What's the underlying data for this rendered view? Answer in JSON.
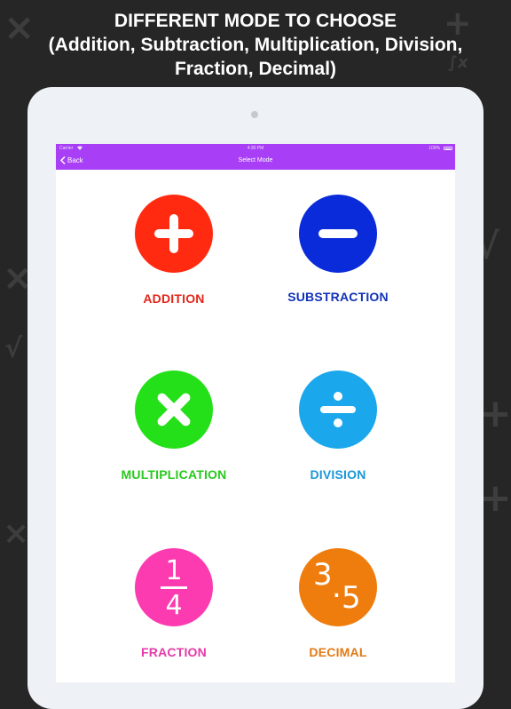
{
  "headline": {
    "line1": "DIFFERENT MODE TO CHOOSE",
    "line2": "(Addition, Subtraction, Multiplication, Division,",
    "line3": "Fraction, Decimal)"
  },
  "status_bar": {
    "carrier": "Carrier",
    "time": "4:30 PM",
    "battery": "100%"
  },
  "nav": {
    "back_label": "Back",
    "title": "Select Mode"
  },
  "modes": [
    {
      "label": "ADDITION",
      "color": "#ff2a0f",
      "icon": "plus-icon"
    },
    {
      "label": "SUBSTRACTION",
      "color": "#0a2bd9",
      "icon": "minus-icon"
    },
    {
      "label": "MULTIPLICATION",
      "color": "#24e019",
      "icon": "multiply-icon"
    },
    {
      "label": "DIVISION",
      "color": "#1aa7ec",
      "icon": "divide-icon"
    },
    {
      "label": "FRACTION",
      "color": "#fc3bb0",
      "icon": "fraction-icon",
      "numerator": "1",
      "denominator": "4"
    },
    {
      "label": "DECIMAL",
      "color": "#ef7d0e",
      "icon": "decimal-icon",
      "whole": "3",
      "dot": ".",
      "fraction": "5"
    }
  ],
  "label_colors": {
    "addition": "#e3261a",
    "substraction": "#1233b8",
    "multiplication": "#28c81e",
    "division": "#1a97d9",
    "fraction": "#e53aa8",
    "decimal": "#e27a15"
  }
}
